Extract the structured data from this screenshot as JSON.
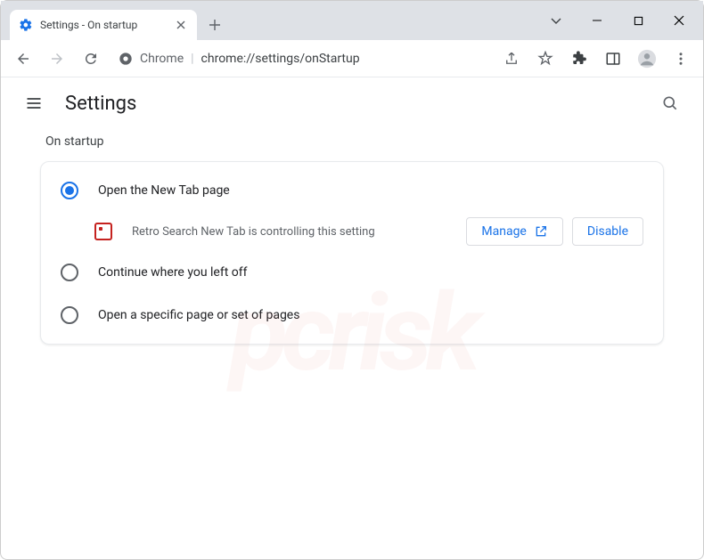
{
  "tab": {
    "title": "Settings - On startup"
  },
  "url": {
    "origin_label": "Chrome",
    "path": "chrome://settings/onStartup"
  },
  "header": {
    "title": "Settings"
  },
  "section": {
    "label": "On startup"
  },
  "options": {
    "new_tab": "Open the New Tab page",
    "continue": "Continue where you left off",
    "specific": "Open a specific page or set of pages"
  },
  "extension_notice": {
    "text": "Retro Search New Tab is controlling this setting",
    "manage_label": "Manage",
    "disable_label": "Disable"
  }
}
